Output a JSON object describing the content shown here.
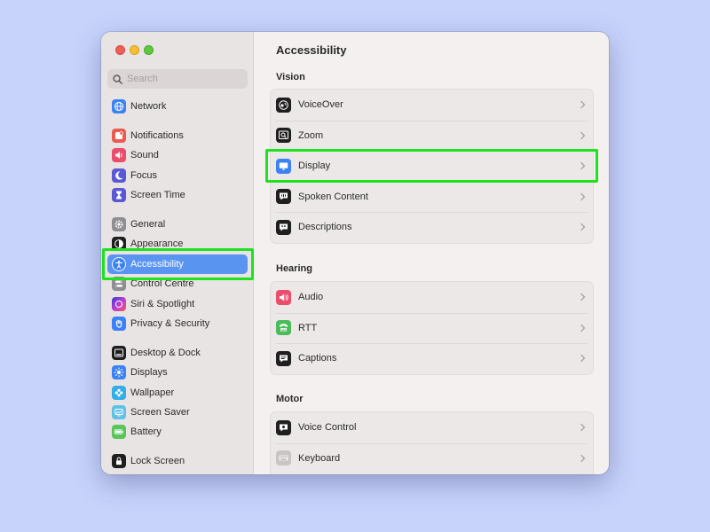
{
  "window": {
    "title": "Accessibility"
  },
  "search": {
    "placeholder": "Search"
  },
  "sidebar": {
    "items": [
      {
        "label": "Network",
        "icon": "globe-icon",
        "color": "#3b82f6"
      },
      {
        "label": "Notifications",
        "icon": "bell-icon",
        "color": "#ec5b4f"
      },
      {
        "label": "Sound",
        "icon": "speaker-icon",
        "color": "#ec4d6b"
      },
      {
        "label": "Focus",
        "icon": "moon-icon",
        "color": "#5a58d6"
      },
      {
        "label": "Screen Time",
        "icon": "hourglass-icon",
        "color": "#5a58d6"
      },
      {
        "label": "General",
        "icon": "gear-icon",
        "color": "#8e8e93"
      },
      {
        "label": "Appearance",
        "icon": "appearance-icon",
        "color": "#1f1f1f"
      },
      {
        "label": "Accessibility",
        "icon": "accessibility-icon",
        "color": "#3b82f6",
        "active": true
      },
      {
        "label": "Control Centre",
        "icon": "control-centre-icon",
        "color": "#8e8e93"
      },
      {
        "label": "Siri & Spotlight",
        "icon": "siri-icon",
        "color": "#c33fd0"
      },
      {
        "label": "Privacy & Security",
        "icon": "hand-icon",
        "color": "#3b82f6"
      },
      {
        "label": "Desktop & Dock",
        "icon": "dock-icon",
        "color": "#1f1f1f"
      },
      {
        "label": "Displays",
        "icon": "sun-icon",
        "color": "#3b82f6"
      },
      {
        "label": "Wallpaper",
        "icon": "flower-icon",
        "color": "#35aee8"
      },
      {
        "label": "Screen Saver",
        "icon": "screen-saver-icon",
        "color": "#5fc0e8"
      },
      {
        "label": "Battery",
        "icon": "battery-icon",
        "color": "#5ac65a"
      },
      {
        "label": "Lock Screen",
        "icon": "lock-icon",
        "color": "#1f1f1f"
      }
    ]
  },
  "main": {
    "sections": [
      {
        "title": "Vision",
        "rows": [
          {
            "label": "VoiceOver",
            "icon": "voiceover-icon"
          },
          {
            "label": "Zoom",
            "icon": "zoom-icon"
          },
          {
            "label": "Display",
            "icon": "display-icon"
          },
          {
            "label": "Spoken Content",
            "icon": "spoken-content-icon"
          },
          {
            "label": "Descriptions",
            "icon": "descriptions-icon"
          }
        ]
      },
      {
        "title": "Hearing",
        "rows": [
          {
            "label": "Audio",
            "icon": "audio-icon"
          },
          {
            "label": "RTT",
            "icon": "rtt-icon"
          },
          {
            "label": "Captions",
            "icon": "captions-icon"
          }
        ]
      },
      {
        "title": "Motor",
        "rows": [
          {
            "label": "Voice Control",
            "icon": "voice-control-icon"
          },
          {
            "label": "Keyboard",
            "icon": "keyboard-icon"
          }
        ]
      }
    ]
  },
  "colors": {
    "accent": "#5994f0",
    "highlight": "#1de21d",
    "background": "#c7d3fb"
  }
}
